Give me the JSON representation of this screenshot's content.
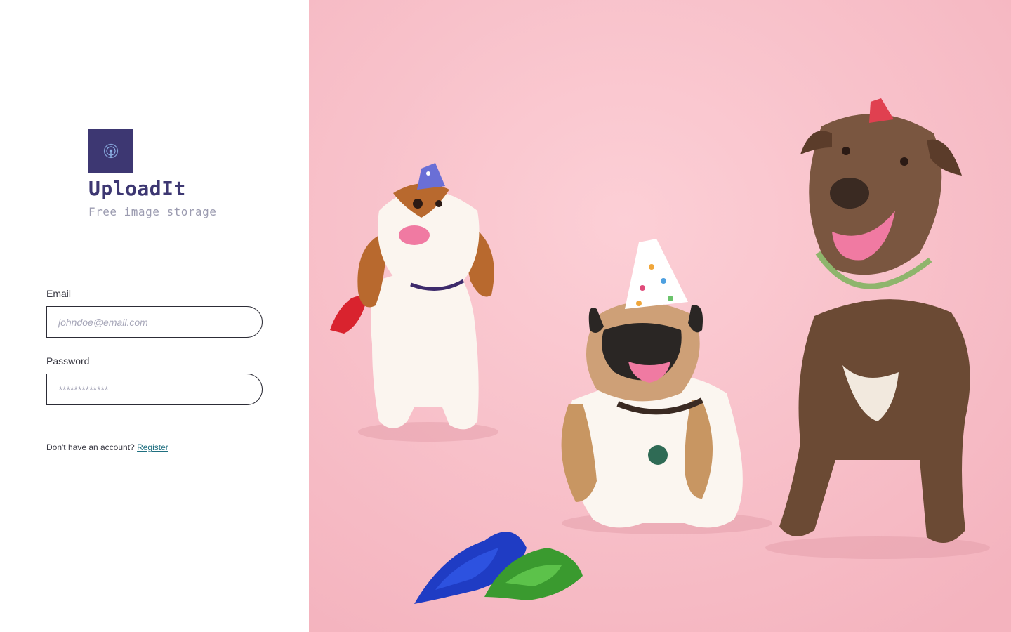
{
  "brand": {
    "name": "UploadIt",
    "tagline": "Free image storage",
    "logo_icon": "upload-signal-icon",
    "logo_color": "#3d3772"
  },
  "login_form": {
    "email": {
      "label": "Email",
      "placeholder": "johndoe@email.com",
      "value": ""
    },
    "password": {
      "label": "Password",
      "placeholder": "*************",
      "value": ""
    }
  },
  "register": {
    "prompt": "Don't have an account?",
    "link_label": "Register"
  },
  "hero_image": {
    "subject": "three-dogs-party-hats",
    "background_color": "#f8bcc6"
  },
  "colors": {
    "accent": "#3d3772",
    "link": "#1f6f80",
    "input_border": "#2c2c36"
  }
}
